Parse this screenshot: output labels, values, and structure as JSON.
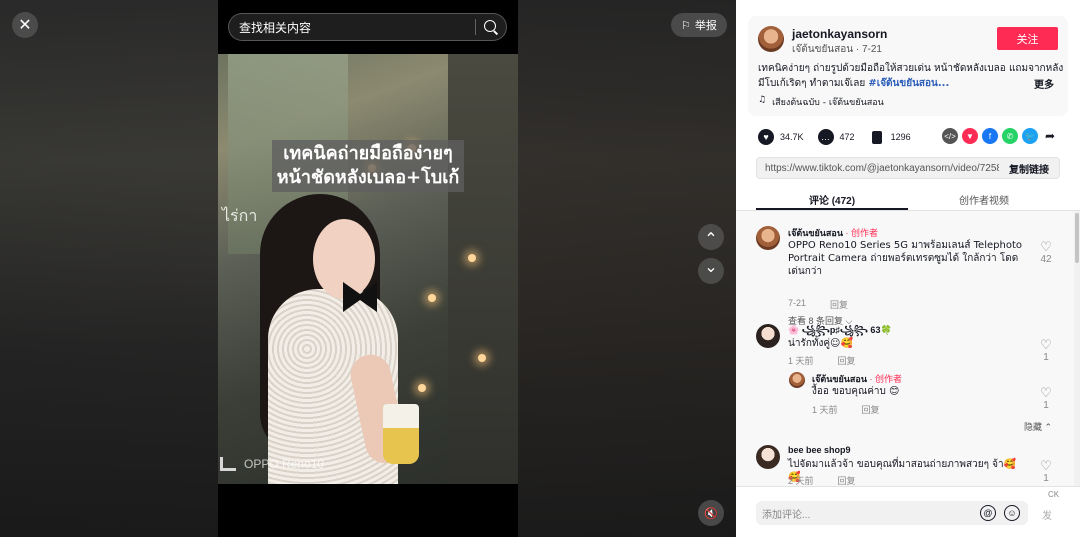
{
  "player": {
    "search_placeholder": "查找相关内容",
    "report_label": "举报",
    "close_glyph": "✕",
    "up_glyph": "⌃",
    "down_glyph": "⌄",
    "mute_glyph": "🔇",
    "caption_line1": "เทคนิคถ่ายมือถือง่ายๆ",
    "caption_line2": "หน้าชัดหลังเบลอ+โบเก้",
    "watermark": "OPPO Reno10"
  },
  "author": {
    "username": "jaetonkayansorn",
    "subtitle": "เจ๊ต้นขยันสอน · 7-21",
    "follow_label": "关注",
    "description": "เทคนิคง่ายๆ ถ่ายรูปด้วยมือถือให้สวยเด่น หน้าชัดหลังเบลอ แถมจากหลังมีโบเก้เริดๆ ทำตามเจ๊เลย ",
    "hashtag": "#เจ๊ต้นขยันสอน...",
    "more_label": "更多",
    "music": "เสียงต้นฉบับ - เจ๊ต้นขยันสอน"
  },
  "stats": {
    "likes": "34.7K",
    "comments": "472",
    "saves": "1296"
  },
  "share_icons": [
    "embed-icon",
    "send-icon",
    "facebook-icon",
    "whatsapp-icon",
    "twitter-icon",
    "share-arrow-icon"
  ],
  "link": {
    "url": "https://www.tiktok.com/@jaetonkayansorn/video/7258...",
    "copy_label": "复制链接"
  },
  "tabs": [
    {
      "label": "评论 (472)",
      "active": true
    },
    {
      "label": "创作者视频",
      "active": false
    }
  ],
  "comments": [
    {
      "name": "เจ๊ต้นขยันสอน",
      "creator_tag": " · 创作者",
      "text": "OPPO Reno10 Series 5G มาพร้อมเลนส์ Telephoto Portrait Camera ถ่ายพอร์ตเทรตซูมได้ ใกล้กว่า โดดเด่นกว่า",
      "time": "7-21",
      "reply_label": "回复",
      "likes": "42",
      "view_replies": "查看 8 条回复 ⌵"
    },
    {
      "name": "🌸 ꧁꧂p♯꧁꧂ 63🍀",
      "text": "น่ารักทั้งคู่☺🥰",
      "time": "1 天前",
      "reply_label": "回复",
      "likes": "1"
    },
    {
      "name": "เจ๊ต้นขยันสอน",
      "creator_tag": " · 创作者",
      "text": "งื้ออ ขอบคุณค่าบ 😊",
      "time": "1 天前",
      "reply_label": "回复",
      "likes": "1",
      "hide_label": "隐藏 ⌃"
    },
    {
      "name": "bee bee shop9",
      "text": "ไปจัดมาแล้วจ้า ขอบคุณที่มาสอนถ่ายภาพสวยๆ จ้า🥰🥰",
      "time": "2 天前",
      "reply_label": "回复",
      "likes": "1"
    }
  ],
  "composer": {
    "placeholder": "添加评论...",
    "post_label": "发",
    "ck_label": "CK"
  }
}
